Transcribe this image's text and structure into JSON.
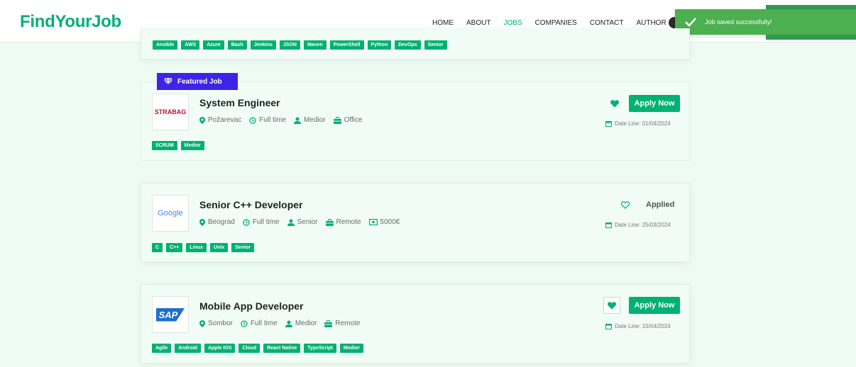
{
  "brand": {
    "name": "FindYourJob"
  },
  "nav": {
    "items": [
      {
        "label": "HOME",
        "active": false
      },
      {
        "label": "ABOUT",
        "active": false
      },
      {
        "label": "JOBS",
        "active": true
      },
      {
        "label": "COMPANIES",
        "active": false
      },
      {
        "label": "CONTACT",
        "active": false
      },
      {
        "label": "AUTHOR",
        "active": false
      }
    ]
  },
  "toast": {
    "message": "Job saved successfully!"
  },
  "featured_badge": "Featured Job",
  "top_card": {
    "tags": [
      "Ansible",
      "AWS",
      "Azure",
      "Bash",
      "Jenkins",
      "JSON",
      "Maven",
      "PowerShell",
      "Python",
      "DevOps",
      "Senior"
    ]
  },
  "jobs": [
    {
      "company_logo": "STRABAG",
      "title": "System Engineer",
      "location": "Požarevac",
      "type": "Full time",
      "level": "Medior",
      "workplace": "Office",
      "tags": [
        "SCRUM",
        "Medior"
      ],
      "saved": true,
      "action": "Apply Now",
      "deadline": "Date Line: 01/04/2024"
    },
    {
      "company_logo": "Google",
      "title": "Senior C++ Developer",
      "location": "Beograd",
      "type": "Full time",
      "level": "Senior",
      "workplace": "Remote",
      "salary": "5000€",
      "tags": [
        "C",
        "C++",
        "Linux",
        "Unix",
        "Senior"
      ],
      "saved": false,
      "action": "Applied",
      "deadline": "Date Line: 25/03/2024"
    },
    {
      "company_logo": "SAP",
      "title": "Mobile App Developer",
      "location": "Sombor",
      "type": "Full time",
      "level": "Medior",
      "workplace": "Remote",
      "tags": [
        "Agile",
        "Android",
        "Apple IOS",
        "Cloud",
        "React Native",
        "TypeScript",
        "Medior"
      ],
      "saved": true,
      "action": "Apply Now",
      "deadline": "Date Line: 15/04/2024"
    }
  ],
  "colors": {
    "brand": "#00b074",
    "featured": "#3d24e8",
    "toast": "#4caf50"
  }
}
